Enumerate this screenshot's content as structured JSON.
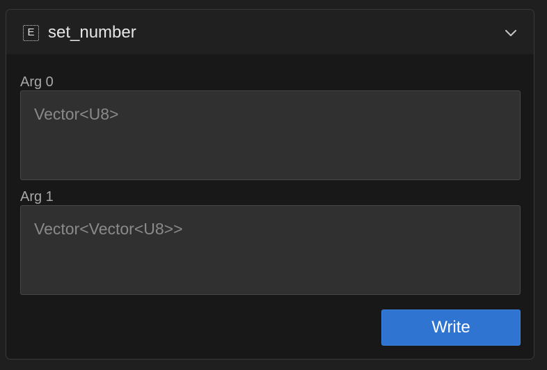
{
  "function_card": {
    "title": "set_number",
    "entry_icon_glyph": "E",
    "entry_icon_name": "entry-function-icon",
    "collapse_icon_name": "chevron-down-icon",
    "args": [
      {
        "label": "Arg 0",
        "placeholder": "Vector<U8>",
        "value": ""
      },
      {
        "label": "Arg 1",
        "placeholder": "Vector<Vector<U8>>",
        "value": ""
      }
    ],
    "write_label": "Write"
  },
  "colors": {
    "background": "#1f1f1f",
    "panel": "#181818",
    "header": "#202020",
    "input": "#303030",
    "accent": "#2f74d0"
  }
}
